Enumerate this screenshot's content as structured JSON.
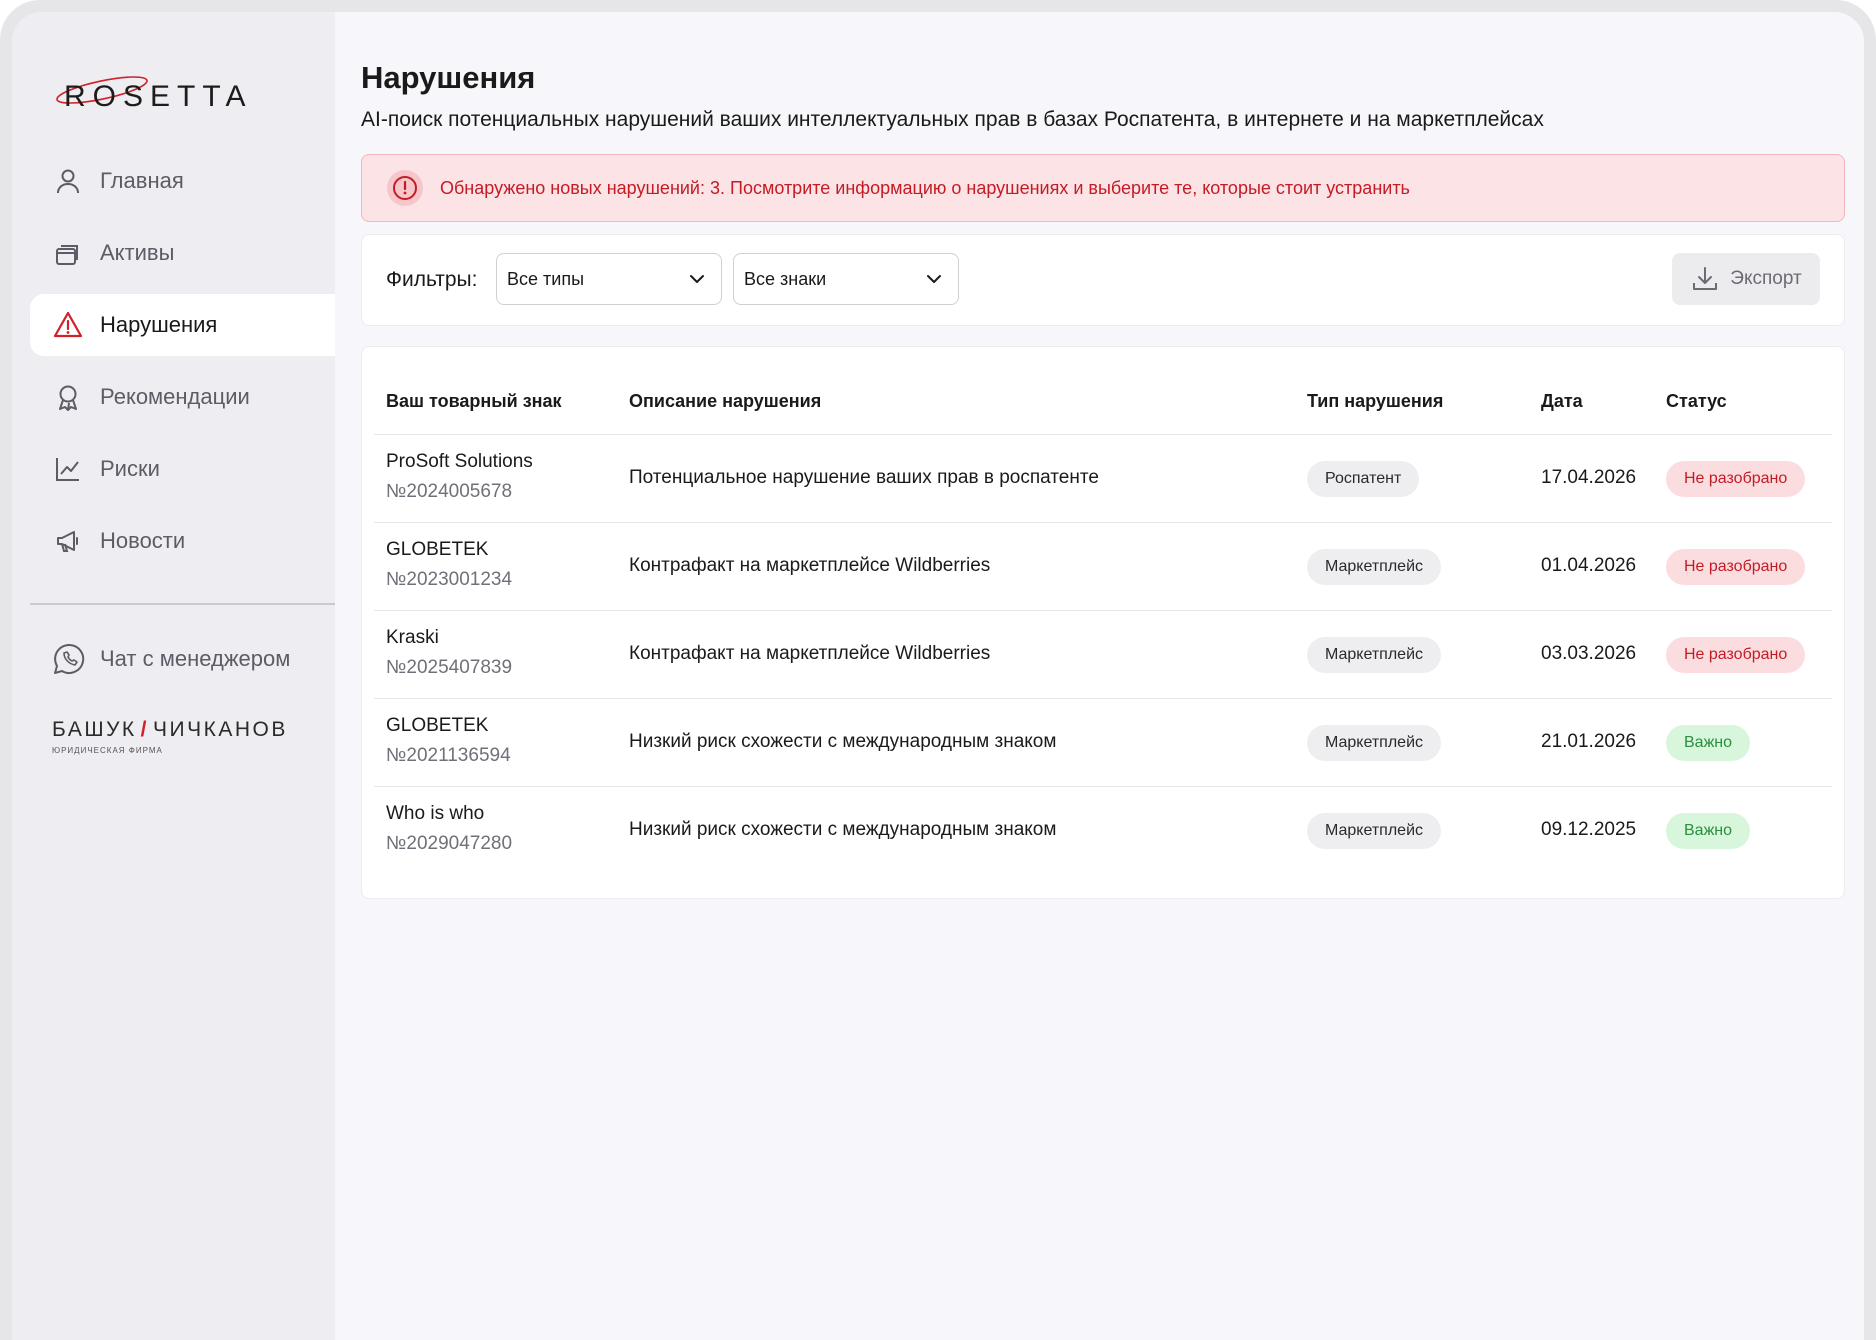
{
  "logo": {
    "text": "ROSETTA"
  },
  "sidebar": {
    "items": [
      {
        "label": "Главная",
        "icon": "user-icon",
        "active": false
      },
      {
        "label": "Активы",
        "icon": "stack-icon",
        "active": false
      },
      {
        "label": "Нарушения",
        "icon": "warning-icon",
        "active": true
      },
      {
        "label": "Рекомендации",
        "icon": "award-icon",
        "active": false
      },
      {
        "label": "Риски",
        "icon": "chart-line-icon",
        "active": false
      },
      {
        "label": "Новости",
        "icon": "megaphone-icon",
        "active": false
      }
    ],
    "chat_label": "Чат с менеджером",
    "firm_left": "БАШУК",
    "firm_slash": "/",
    "firm_right": "ЧИЧКАНОВ",
    "firm_sub": "ЮРИДИЧЕСКАЯ ФИРМА"
  },
  "page": {
    "title": "Нарушения",
    "subtitle": "AI-поиск потенциальных нарушений ваших интеллектуальных прав в базах Роспатента, в интернете и на маркетплейсах"
  },
  "alert": {
    "text": "Обнаружено новых нарушений: 3. Посмотрите информацию о нарушениях и выберите те, которые стоит устранить"
  },
  "filters": {
    "label": "Фильтры:",
    "type_select": "Все типы",
    "mark_select": "Все знаки",
    "export_label": "Экспорт"
  },
  "table": {
    "headers": {
      "mark": "Ваш товарный знак",
      "desc": "Описание нарушения",
      "type": "Тип нарушения",
      "date": "Дата",
      "status": "Статус"
    },
    "rows": [
      {
        "name": "ProSoft Solutions",
        "number": "№2024005678",
        "desc": "Потенциальное нарушение ваших прав в роспатенте",
        "type": "Роспатент",
        "date": "17.04.2026",
        "status": "Не разобрано",
        "status_kind": "new"
      },
      {
        "name": "GLOBETEK",
        "number": "№2023001234",
        "desc": "Контрафакт на маркетплейсе Wildberries",
        "type": "Маркетплейс",
        "date": "01.04.2026",
        "status": "Не разобрано",
        "status_kind": "new"
      },
      {
        "name": "Kraski",
        "number": "№2025407839",
        "desc": "Контрафакт на маркетплейсе Wildberries",
        "type": "Маркетплейс",
        "date": "03.03.2026",
        "status": "Не разобрано",
        "status_kind": "new"
      },
      {
        "name": "GLOBETEK",
        "number": "№2021136594",
        "desc": "Низкий риск схожести с международным знаком",
        "type": "Маркетплейс",
        "date": "21.01.2026",
        "status": "Важно",
        "status_kind": "important"
      },
      {
        "name": "Who is who",
        "number": "№2029047280",
        "desc": "Низкий риск схожести с международным знаком",
        "type": "Маркетплейс",
        "date": "09.12.2025",
        "status": "Важно",
        "status_kind": "important"
      }
    ]
  },
  "colors": {
    "accent_red": "#c41b24",
    "alert_bg": "#fbe3e6",
    "important_bg": "#d7f6dc",
    "important_text": "#2a8f3e"
  }
}
